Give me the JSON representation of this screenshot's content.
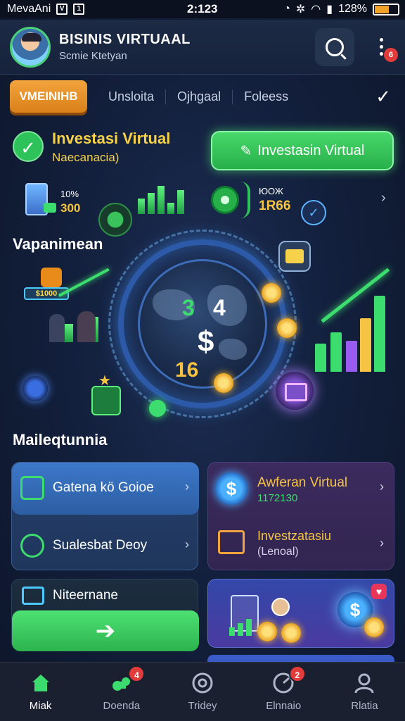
{
  "status_bar": {
    "carrier": "MevaAni",
    "icon1": "V",
    "icon2": "1",
    "time": "2:123",
    "battery": "128%"
  },
  "header": {
    "title": "BISINIS VIRTUAAL",
    "subtitle": "Scmie Ktetyan",
    "notification_count": "6"
  },
  "tabs": {
    "active": "VMEINIHB",
    "items": [
      "Unsloita",
      "Ojhgaal",
      "Foleess"
    ]
  },
  "investment": {
    "title": "Investasi Virtual",
    "subtitle": "Naecanacia)",
    "cta_label": "Investasin Virtual"
  },
  "stats": {
    "a_small": "10%",
    "a_value": "300",
    "b_small": "ЮОЖ",
    "b_value": "1R66",
    "chevron": "›"
  },
  "hub": {
    "section_label": "Vapanimean",
    "num1": "3",
    "num2": "4",
    "dollar": "$",
    "num3": "16",
    "tag_value": "$1000"
  },
  "section": {
    "label": "Maileqtunnia"
  },
  "cards": {
    "blue": [
      {
        "label": "Gatena  kö Goioe",
        "chevron": "›"
      },
      {
        "label": "Sualesbat Deoy",
        "chevron": "›"
      }
    ],
    "purple": {
      "title": "Awferan Virtual",
      "value": "1172130",
      "title2": "Investzatasiu",
      "sub2": "(Lenoal)",
      "dollar": "$",
      "chevron": "›"
    },
    "dark": {
      "label": "Niteernane",
      "cta_arrow": "➔"
    },
    "illus": {
      "dollar": "$",
      "heart": "♥"
    }
  },
  "bottom_nav": [
    {
      "label": "Miak",
      "icon": "home-icon",
      "badge": ""
    },
    {
      "label": "Doenda",
      "icon": "puzzle-icon",
      "badge": "4"
    },
    {
      "label": "Tridey",
      "icon": "target-icon",
      "badge": ""
    },
    {
      "label": "Elnnaio",
      "icon": "gauge-icon",
      "badge": "2"
    },
    {
      "label": "Rlatia",
      "icon": "user-icon",
      "badge": ""
    }
  ],
  "colors": {
    "accent_green": "#3ddc6e",
    "accent_orange": "#f3a43d",
    "accent_gold": "#f6c342",
    "background": "#13203d"
  }
}
